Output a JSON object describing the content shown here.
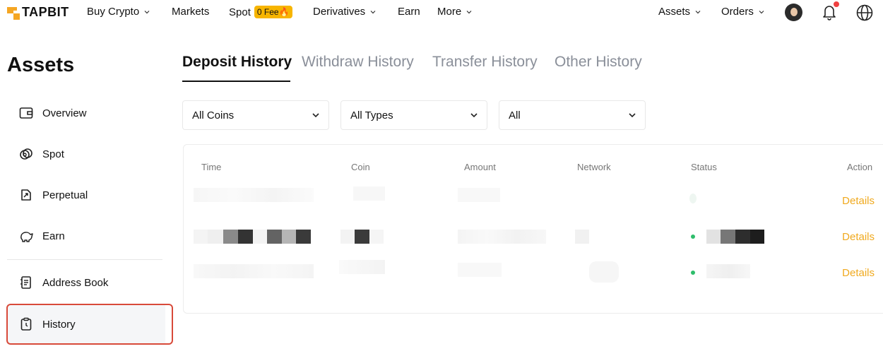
{
  "brand": {
    "name": "TAPBIT",
    "accent": "#f5a623"
  },
  "nav": {
    "buy_crypto": "Buy Crypto",
    "markets": "Markets",
    "spot": "Spot",
    "spot_badge": "0 Fee🔥",
    "derivatives": "Derivatives",
    "earn": "Earn",
    "more": "More",
    "assets": "Assets",
    "orders": "Orders"
  },
  "sidebar": {
    "title": "Assets",
    "items": [
      {
        "label": "Overview",
        "icon": "wallet-icon"
      },
      {
        "label": "Spot",
        "icon": "coins-icon"
      },
      {
        "label": "Perpetual",
        "icon": "perpetual-icon"
      },
      {
        "label": "Earn",
        "icon": "piggy-bank-icon"
      },
      {
        "label": "Address Book",
        "icon": "address-book-icon"
      },
      {
        "label": "History",
        "icon": "history-icon",
        "active": true
      }
    ]
  },
  "tabs": [
    "Deposit History",
    "Withdraw History",
    "Transfer History",
    "Other History"
  ],
  "active_tab": "Deposit History",
  "filters": {
    "coin": "All Coins",
    "type": "All Types",
    "status": "All"
  },
  "table": {
    "headers": {
      "time": "Time",
      "coin": "Coin",
      "amount": "Amount",
      "network": "Network",
      "status": "Status",
      "action": "Action"
    },
    "rows": [
      {
        "action": "Details"
      },
      {
        "action": "Details"
      },
      {
        "action": "Details"
      }
    ]
  },
  "colors": {
    "action": "#f0a91e",
    "highlight_border": "#d84a3a",
    "status_ok": "#2ebd6b"
  }
}
